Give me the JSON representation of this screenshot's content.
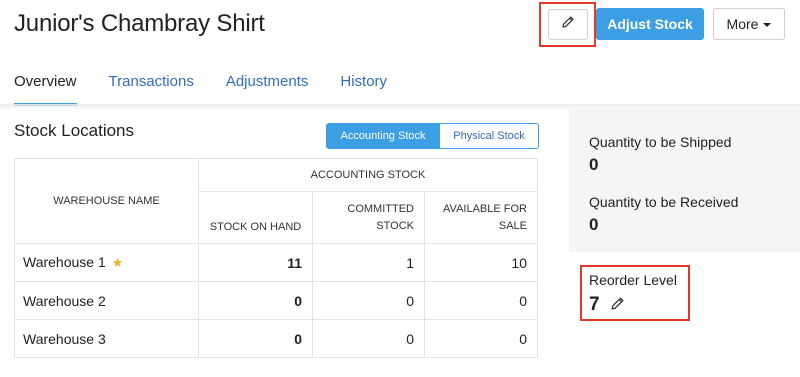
{
  "header": {
    "title": "Junior's Chambray Shirt",
    "edit_icon": "pencil-icon",
    "adjust_stock_label": "Adjust Stock",
    "more_label": "More"
  },
  "tabs": [
    {
      "label": "Overview",
      "active": true
    },
    {
      "label": "Transactions",
      "active": false
    },
    {
      "label": "Adjustments",
      "active": false
    },
    {
      "label": "History",
      "active": false
    }
  ],
  "stock_locations": {
    "title": "Stock Locations",
    "toggle": {
      "accounting": "Accounting Stock",
      "physical": "Physical Stock",
      "selected": "Accounting Stock"
    },
    "columns": {
      "warehouse": "WAREHOUSE NAME",
      "group": "ACCOUNTING STOCK",
      "on_hand": "STOCK ON HAND",
      "committed_1": "COMMITTED",
      "committed_2": "STOCK",
      "available_1": "AVAILABLE FOR",
      "available_2": "SALE"
    },
    "rows": [
      {
        "name": "Warehouse 1",
        "primary": true,
        "on_hand": "11",
        "committed": "1",
        "available": "10"
      },
      {
        "name": "Warehouse 2",
        "primary": false,
        "on_hand": "0",
        "committed": "0",
        "available": "0"
      },
      {
        "name": "Warehouse 3",
        "primary": false,
        "on_hand": "0",
        "committed": "0",
        "available": "0"
      }
    ]
  },
  "summary": {
    "to_ship_label": "Quantity to be Shipped",
    "to_ship_value": "0",
    "to_receive_label": "Quantity to be Received",
    "to_receive_value": "0"
  },
  "reorder": {
    "label": "Reorder Level",
    "value": "7"
  },
  "colors": {
    "accent": "#3c9fe3",
    "link": "#2f6fbd",
    "highlight_border": "#e23b2c",
    "star": "#f0b52f"
  }
}
